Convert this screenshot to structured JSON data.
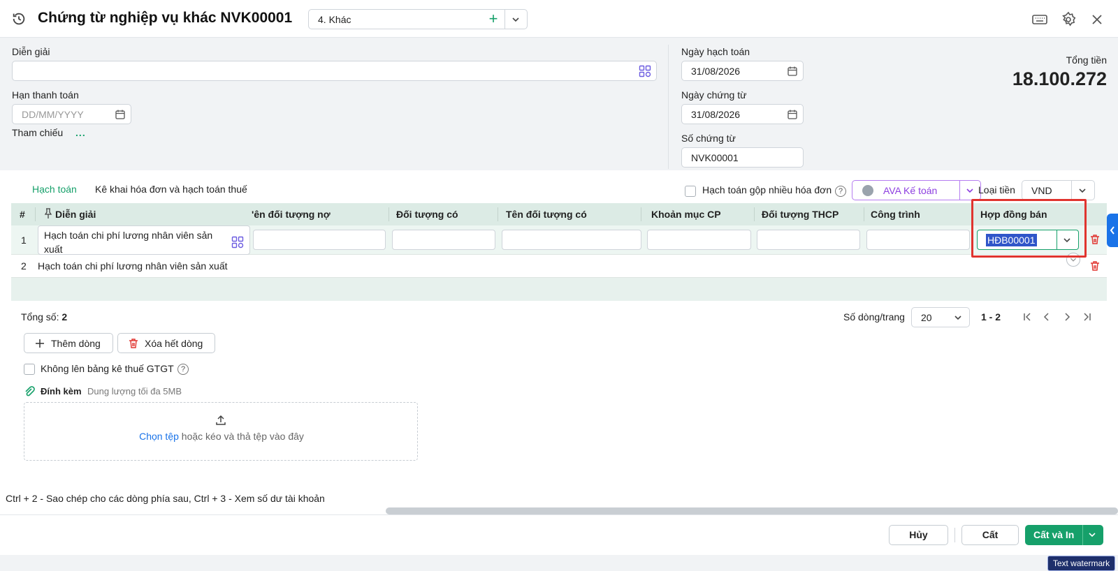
{
  "header": {
    "title": "Chứng từ nghiệp vụ khác NVK00001",
    "type_value": "4. Khác"
  },
  "form": {
    "description_label": "Diễn giải",
    "description_value": "",
    "due_label": "Hạn thanh toán",
    "due_placeholder": "DD/MM/YYYY",
    "reference_label": "Tham chiếu",
    "reference_more": "...",
    "posting_date_label": "Ngày hạch toán",
    "posting_date_value": "31/08/2026",
    "voucher_date_label": "Ngày chứng từ",
    "voucher_date_value": "31/08/2026",
    "voucher_no_label": "Số chứng từ",
    "voucher_no_value": "NVK00001",
    "total_label": "Tổng tiền",
    "total_value": "18.100.272"
  },
  "tabs": [
    {
      "label": "Hạch toán",
      "active": true
    },
    {
      "label": "Kê khai hóa đơn và hạch toán thuế",
      "active": false
    }
  ],
  "toolbar": {
    "merge_label": "Hạch toán gộp nhiều hóa đơn",
    "ava_label": "AVA Kế toán",
    "currency_label": "Loại tiền",
    "currency_value": "VND"
  },
  "grid": {
    "columns": [
      "#",
      "Diễn giải",
      "'ên đối tượng nợ",
      "Đối tượng có",
      "Tên đối tượng có",
      "Khoản mục CP",
      "Đối tượng THCP",
      "Công trình",
      "Hợp đồng bán"
    ],
    "rows": [
      {
        "index": "1",
        "description": "Hạch toán chi phí lương nhân viên sản xuất",
        "contract": "HĐB00001"
      },
      {
        "index": "2",
        "description": "Hạch toán chi phí lương nhân viên sản xuất",
        "contract": ""
      }
    ]
  },
  "footer": {
    "total_rows_label": "Tổng số:",
    "total_rows_value": "2",
    "rows_per_page_label": "Số dòng/trang",
    "rows_per_page_value": "20",
    "range": "1 - 2",
    "add_row": "Thêm dòng",
    "delete_all": "Xóa hết dòng",
    "no_vat_label": "Không lên bảng kê thuế GTGT",
    "attach_label": "Đính kèm",
    "attach_limit": "Dung lượng tối đa 5MB",
    "choose_file": "Chọn tệp",
    "drop_text": " hoặc kéo và thả tệp vào đây"
  },
  "hint": "Ctrl + 2 - Sao chép cho các dòng phía sau, Ctrl + 3 - Xem số dư tài khoản",
  "actions": {
    "cancel": "Hủy",
    "save": "Cất",
    "save_print": "Cất và In"
  },
  "watermark": "Text watermark",
  "colors": {
    "accent": "#16a06a",
    "highlight": "#e0342f",
    "ava": "#8d3fe0",
    "link": "#1a73e8"
  }
}
